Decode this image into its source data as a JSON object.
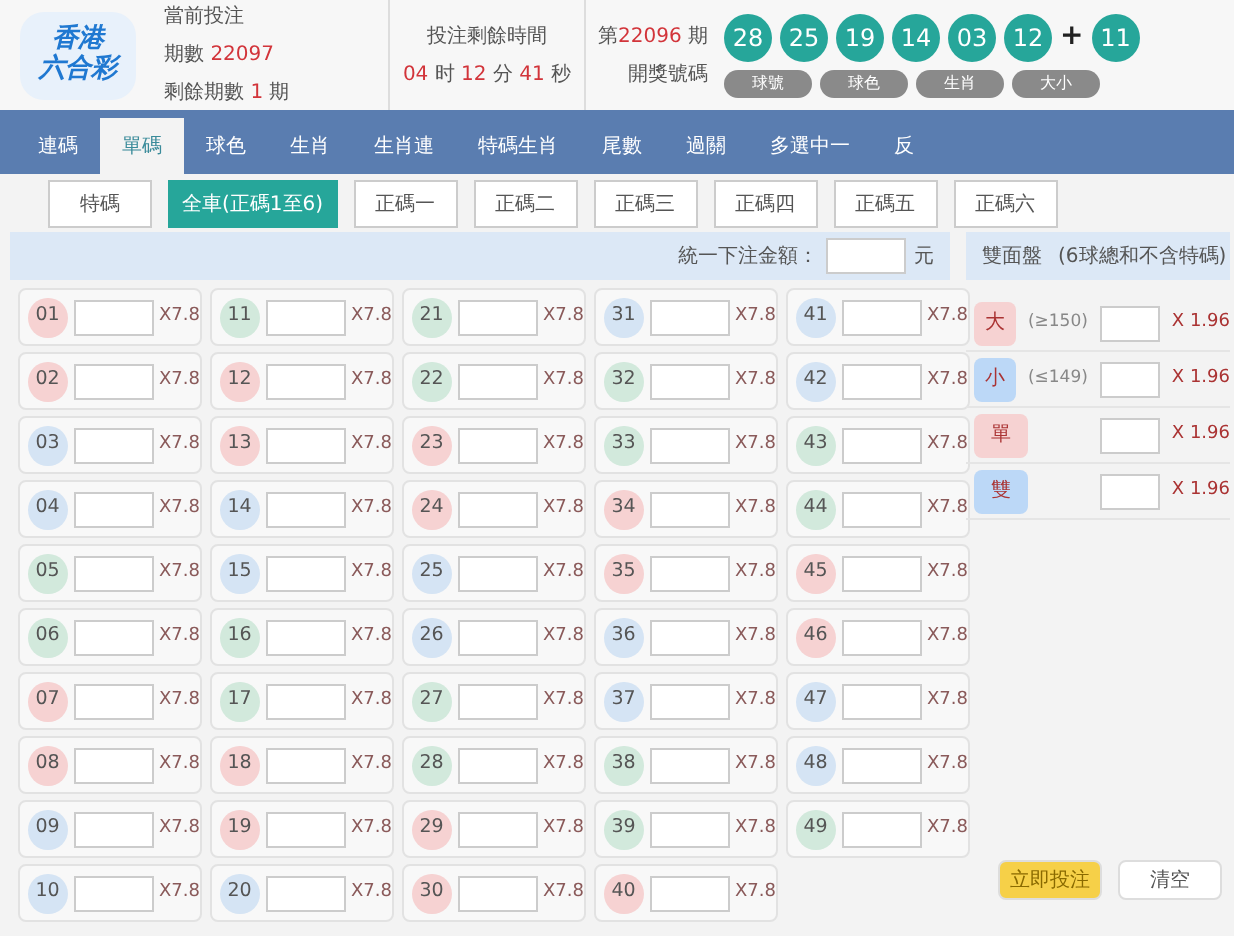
{
  "header": {
    "logo_lines": [
      "香港",
      "六合彩"
    ],
    "current": {
      "title": "當前投注",
      "period_label": "期數",
      "period": "22097",
      "remaining_label": "剩餘期數",
      "remaining": "1",
      "remaining_unit": "期"
    },
    "countdown": {
      "title": "投注剩餘時間",
      "parts": [
        {
          "value": "04",
          "unit": "时"
        },
        {
          "value": "12",
          "unit": "分"
        },
        {
          "value": "41",
          "unit": "秒"
        }
      ]
    },
    "draw": {
      "prefix": "第",
      "period": "22096",
      "suffix": "期",
      "label": "開獎號碼"
    },
    "balls": [
      "28",
      "25",
      "19",
      "14",
      "03",
      "12"
    ],
    "plus": "+",
    "special_ball": "11",
    "ball_tabs": [
      "球號",
      "球色",
      "生肖",
      "大小"
    ]
  },
  "nav": [
    {
      "label": "連碼",
      "selected": false
    },
    {
      "label": "單碼",
      "selected": true
    },
    {
      "label": "球色",
      "selected": false
    },
    {
      "label": "生肖",
      "selected": false
    },
    {
      "label": "生肖連",
      "selected": false
    },
    {
      "label": "特碼生肖",
      "selected": false
    },
    {
      "label": "尾數",
      "selected": false
    },
    {
      "label": "過關",
      "selected": false
    },
    {
      "label": "多選中一",
      "selected": false
    },
    {
      "label": "反",
      "selected": false
    }
  ],
  "sub_tabs": [
    {
      "label": "特碼",
      "selected": false
    },
    {
      "label": "全車(正碼1至6)",
      "selected": true
    },
    {
      "label": "正碼一",
      "selected": false
    },
    {
      "label": "正碼二",
      "selected": false
    },
    {
      "label": "正碼三",
      "selected": false
    },
    {
      "label": "正碼四",
      "selected": false
    },
    {
      "label": "正碼五",
      "selected": false
    },
    {
      "label": "正碼六",
      "selected": false
    }
  ],
  "unified_bet": {
    "label": "統一下注金額：",
    "unit": "元"
  },
  "number_grid": [
    [
      {
        "number": "01",
        "color": "#f6d2d2",
        "odds": "X7.8"
      },
      {
        "number": "02",
        "color": "#f6d2d2",
        "odds": "X7.8"
      },
      {
        "number": "03",
        "color": "#d5e4f4",
        "odds": "X7.8"
      },
      {
        "number": "04",
        "color": "#d5e4f4",
        "odds": "X7.8"
      },
      {
        "number": "05",
        "color": "#d2e9dc",
        "odds": "X7.8"
      },
      {
        "number": "06",
        "color": "#d2e9dc",
        "odds": "X7.8"
      },
      {
        "number": "07",
        "color": "#f6d2d2",
        "odds": "X7.8"
      },
      {
        "number": "08",
        "color": "#f6d2d2",
        "odds": "X7.8"
      },
      {
        "number": "09",
        "color": "#d5e4f4",
        "odds": "X7.8"
      },
      {
        "number": "10",
        "color": "#d5e4f4",
        "odds": "X7.8"
      }
    ],
    [
      {
        "number": "11",
        "color": "#d2e9dc",
        "odds": "X7.8"
      },
      {
        "number": "12",
        "color": "#f6d2d2",
        "odds": "X7.8"
      },
      {
        "number": "13",
        "color": "#f6d2d2",
        "odds": "X7.8"
      },
      {
        "number": "14",
        "color": "#d5e4f4",
        "odds": "X7.8"
      },
      {
        "number": "15",
        "color": "#d5e4f4",
        "odds": "X7.8"
      },
      {
        "number": "16",
        "color": "#d2e9dc",
        "odds": "X7.8"
      },
      {
        "number": "17",
        "color": "#d2e9dc",
        "odds": "X7.8"
      },
      {
        "number": "18",
        "color": "#f6d2d2",
        "odds": "X7.8"
      },
      {
        "number": "19",
        "color": "#f6d2d2",
        "odds": "X7.8"
      },
      {
        "number": "20",
        "color": "#d5e4f4",
        "odds": "X7.8"
      }
    ],
    [
      {
        "number": "21",
        "color": "#d2e9dc",
        "odds": "X7.8"
      },
      {
        "number": "22",
        "color": "#d2e9dc",
        "odds": "X7.8"
      },
      {
        "number": "23",
        "color": "#f6d2d2",
        "odds": "X7.8"
      },
      {
        "number": "24",
        "color": "#f6d2d2",
        "odds": "X7.8"
      },
      {
        "number": "25",
        "color": "#d5e4f4",
        "odds": "X7.8"
      },
      {
        "number": "26",
        "color": "#d5e4f4",
        "odds": "X7.8"
      },
      {
        "number": "27",
        "color": "#d2e9dc",
        "odds": "X7.8"
      },
      {
        "number": "28",
        "color": "#d2e9dc",
        "odds": "X7.8"
      },
      {
        "number": "29",
        "color": "#f6d2d2",
        "odds": "X7.8"
      },
      {
        "number": "30",
        "color": "#f6d2d2",
        "odds": "X7.8"
      }
    ],
    [
      {
        "number": "31",
        "color": "#d5e4f4",
        "odds": "X7.8"
      },
      {
        "number": "32",
        "color": "#d2e9dc",
        "odds": "X7.8"
      },
      {
        "number": "33",
        "color": "#d2e9dc",
        "odds": "X7.8"
      },
      {
        "number": "34",
        "color": "#f6d2d2",
        "odds": "X7.8"
      },
      {
        "number": "35",
        "color": "#f6d2d2",
        "odds": "X7.8"
      },
      {
        "number": "36",
        "color": "#d5e4f4",
        "odds": "X7.8"
      },
      {
        "number": "37",
        "color": "#d5e4f4",
        "odds": "X7.8"
      },
      {
        "number": "38",
        "color": "#d2e9dc",
        "odds": "X7.8"
      },
      {
        "number": "39",
        "color": "#d2e9dc",
        "odds": "X7.8"
      },
      {
        "number": "40",
        "color": "#f6d2d2",
        "odds": "X7.8"
      }
    ],
    [
      {
        "number": "41",
        "color": "#d5e4f4",
        "odds": "X7.8"
      },
      {
        "number": "42",
        "color": "#d5e4f4",
        "odds": "X7.8"
      },
      {
        "number": "43",
        "color": "#d2e9dc",
        "odds": "X7.8"
      },
      {
        "number": "44",
        "color": "#d2e9dc",
        "odds": "X7.8"
      },
      {
        "number": "45",
        "color": "#f6d2d2",
        "odds": "X7.8"
      },
      {
        "number": "46",
        "color": "#f6d2d2",
        "odds": "X7.8"
      },
      {
        "number": "47",
        "color": "#d5e4f4",
        "odds": "X7.8"
      },
      {
        "number": "48",
        "color": "#d5e4f4",
        "odds": "X7.8"
      },
      {
        "number": "49",
        "color": "#d2e9dc",
        "odds": "X7.8"
      }
    ]
  ],
  "two_sides": {
    "title": "雙面盤",
    "note": "(6球總和不含特碼)",
    "items": [
      {
        "label": "大",
        "hint": "(≥150)",
        "color": "#f6d2d2",
        "odds": "X 1.96"
      },
      {
        "label": "小",
        "hint": "(≤149)",
        "color": "#bcd8f7",
        "odds": "X 1.96"
      },
      {
        "label": "單",
        "color": "#f6d2d2",
        "odds": "X 1.96"
      },
      {
        "label": "雙",
        "color": "#bcd8f7",
        "odds": "X 1.96"
      }
    ]
  },
  "actions": [
    {
      "label": "立即投注",
      "kind": "primary"
    },
    {
      "label": "清空",
      "kind": "secondary"
    }
  ]
}
